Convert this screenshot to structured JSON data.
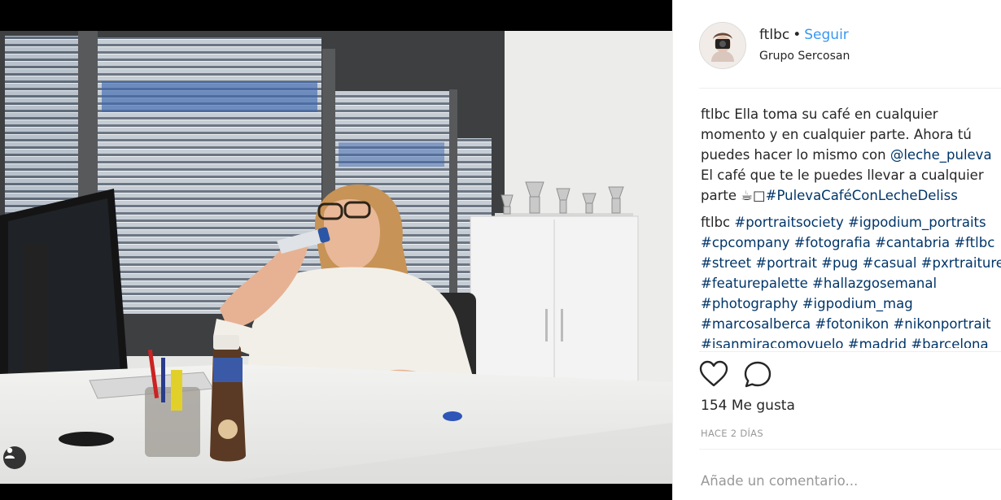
{
  "post": {
    "username": "ftlbc",
    "separator": "•",
    "follow_label": "Seguir",
    "location": "Grupo Sercosan"
  },
  "caption": {
    "author": "ftlbc",
    "lines": [
      "Ella toma su café en cualquier",
      "momento y en cualquier parte. Ahora tú",
      "puedes hacer lo mismo con "
    ],
    "mention": "@leche_puleva",
    "line4": "El café que te le puedes llevar a cualquier",
    "line5_prefix": "parte ",
    "line5_emoji": "☕□",
    "line5_hashtag": "#PulevaCaféConLecheDeliss"
  },
  "hashtag_comment": {
    "author": "ftlbc",
    "first_line": "#portraitsociety #igpodium_portraits",
    "lines": [
      "#cpcompany #fotografia #cantabria #ftlbc",
      "#street #portrait #pug #casual #pxrtraiture",
      "#featurepalette #hallazgosemanal",
      "#photography #igpodium_mag",
      "#marcosalberca #fotonikon #nikonportrait",
      "#isanmiracomovuelo #madrid #barcelona"
    ]
  },
  "likes": "154 Me gusta",
  "timestamp": "HACE 2 DÍAS",
  "comment_input": {
    "placeholder": "Añade un comentario..."
  },
  "icons": {
    "like": "heart-outline-icon",
    "comment": "speech-bubble-icon",
    "tag": "person-tag-icon"
  },
  "colors": {
    "follow": "#3897f0",
    "link": "#003569",
    "muted": "#999999",
    "text": "#262626"
  }
}
